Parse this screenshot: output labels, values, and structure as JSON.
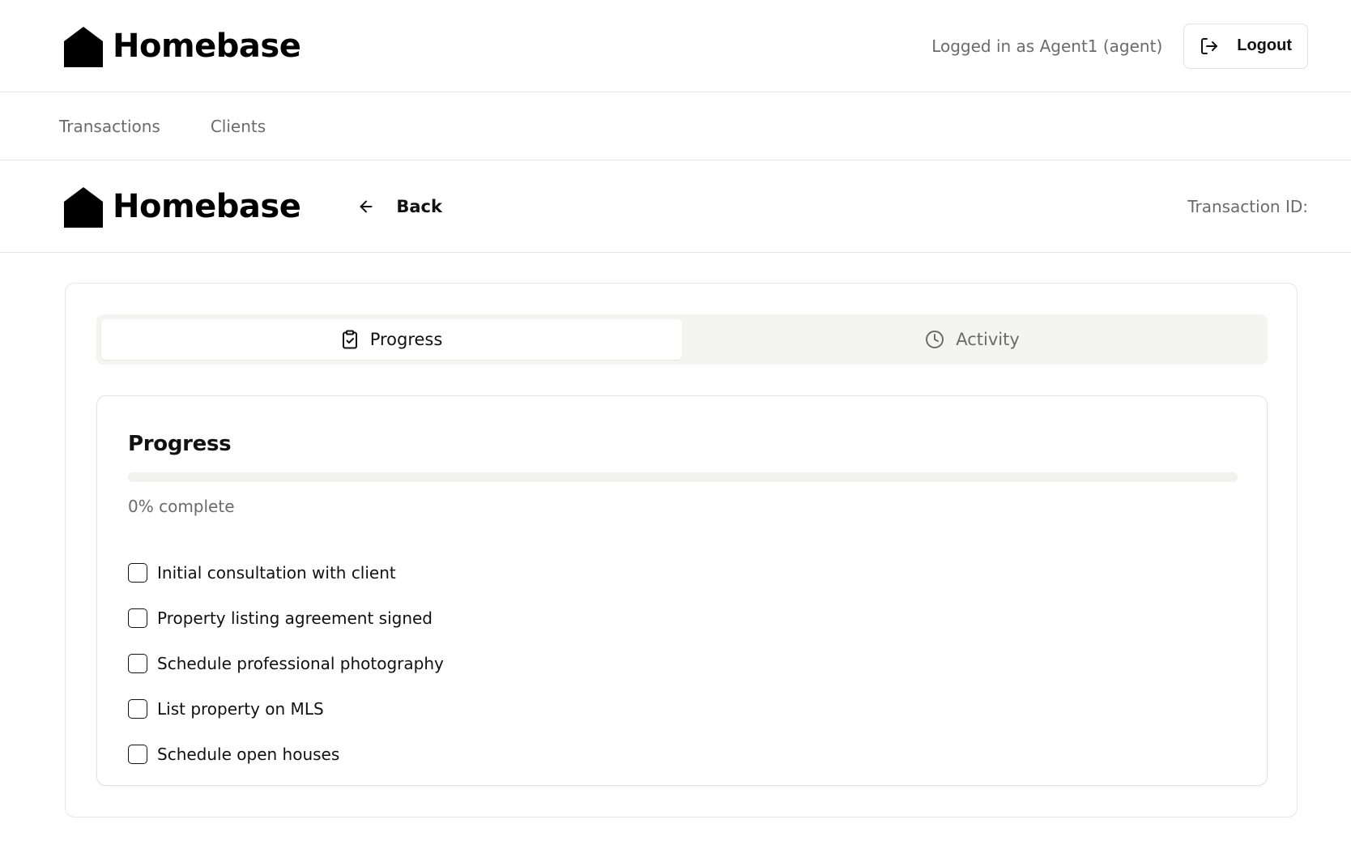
{
  "app": {
    "brand": "Homebase",
    "user_info": "Logged in as Agent1 (agent)",
    "logout_label": "Logout"
  },
  "nav": {
    "items": [
      {
        "label": "Transactions"
      },
      {
        "label": "Clients"
      }
    ]
  },
  "subheader": {
    "brand": "Homebase",
    "back_label": "Back",
    "transaction_id_label": "Transaction ID:"
  },
  "tabs": [
    {
      "label": "Progress",
      "icon": "clipboard-check-icon",
      "active": true
    },
    {
      "label": "Activity",
      "icon": "clock-icon",
      "active": false
    }
  ],
  "progress": {
    "title": "Progress",
    "percent": 0,
    "status_text": "0% complete",
    "items": [
      {
        "label": "Initial consultation with client",
        "checked": false
      },
      {
        "label": "Property listing agreement signed",
        "checked": false
      },
      {
        "label": "Schedule professional photography",
        "checked": false
      },
      {
        "label": "List property on MLS",
        "checked": false
      },
      {
        "label": "Schedule open houses",
        "checked": false
      }
    ]
  },
  "colors": {
    "accent": "#111111",
    "muted_text": "#6b6b6b",
    "tab_bg": "#f4f4f3",
    "border": "#e6e6e6"
  }
}
